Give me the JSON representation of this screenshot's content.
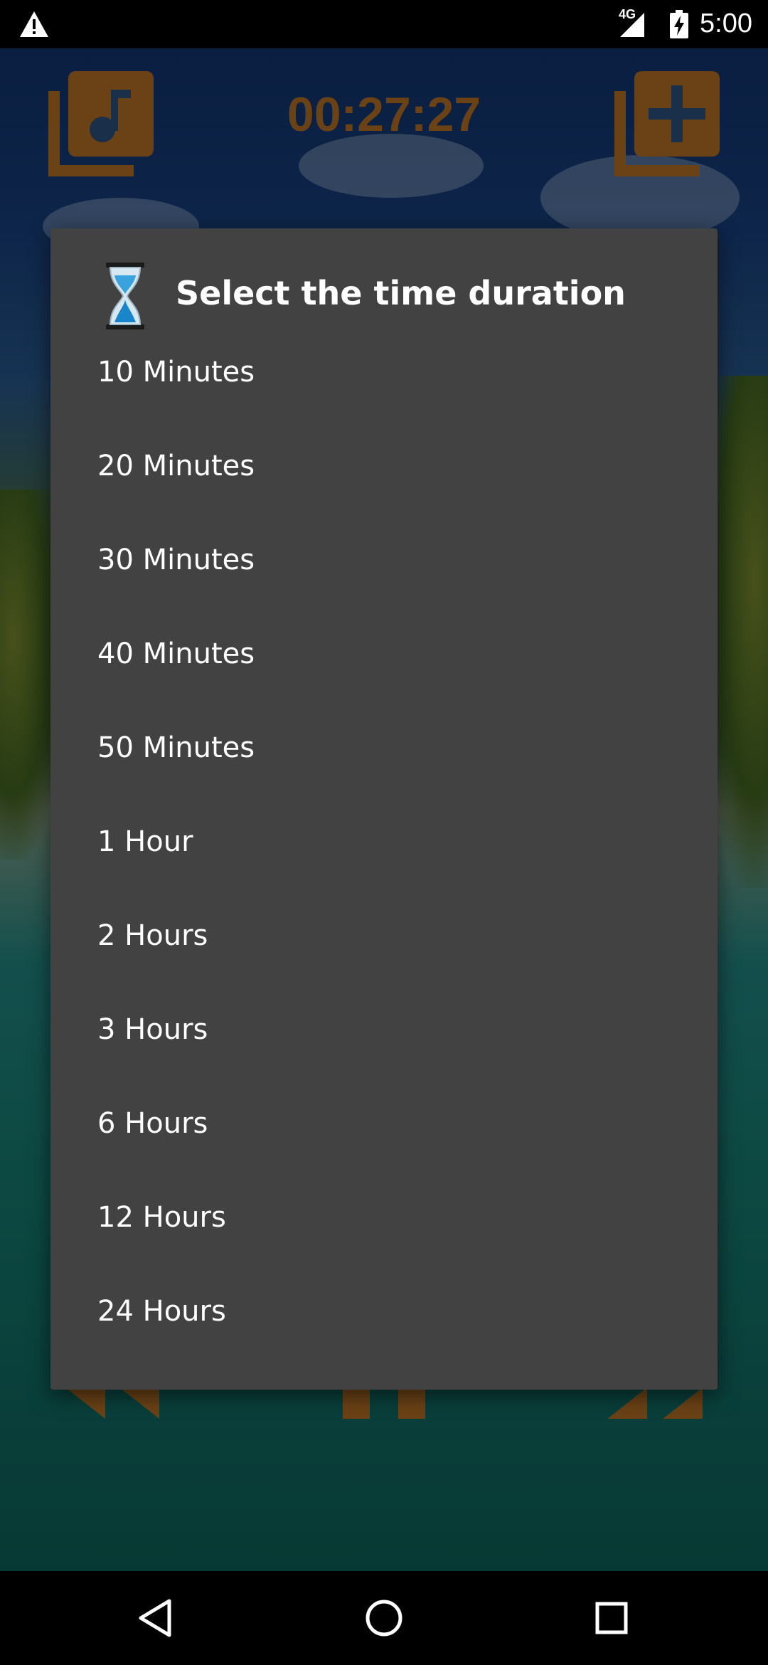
{
  "status_bar": {
    "network_label": "4G",
    "time": "5:00",
    "icons": [
      "warning-icon",
      "signal-icon",
      "battery-charging-icon"
    ]
  },
  "toolbar": {
    "timer": "00:27:27",
    "icons": [
      "playlist-music-icon",
      "add-to-playlist-icon"
    ]
  },
  "dialog": {
    "title": "Select the time duration",
    "title_icon": "hourglass-icon",
    "options": [
      "10 Minutes",
      "20 Minutes",
      "30 Minutes",
      "40 Minutes",
      "50 Minutes",
      "1 Hour",
      "2 Hours",
      "3 Hours",
      "6 Hours",
      "12 Hours",
      "24 Hours"
    ]
  },
  "controls": {
    "icons": [
      "rewind-icon",
      "pause-icon",
      "fast-forward-icon"
    ]
  },
  "nav_bar": {
    "icons": [
      "back-icon",
      "home-icon",
      "recents-icon"
    ]
  },
  "colors": {
    "dialog_bg": "#424242",
    "accent_brown": "#6b4216",
    "text": "#ffffff"
  }
}
